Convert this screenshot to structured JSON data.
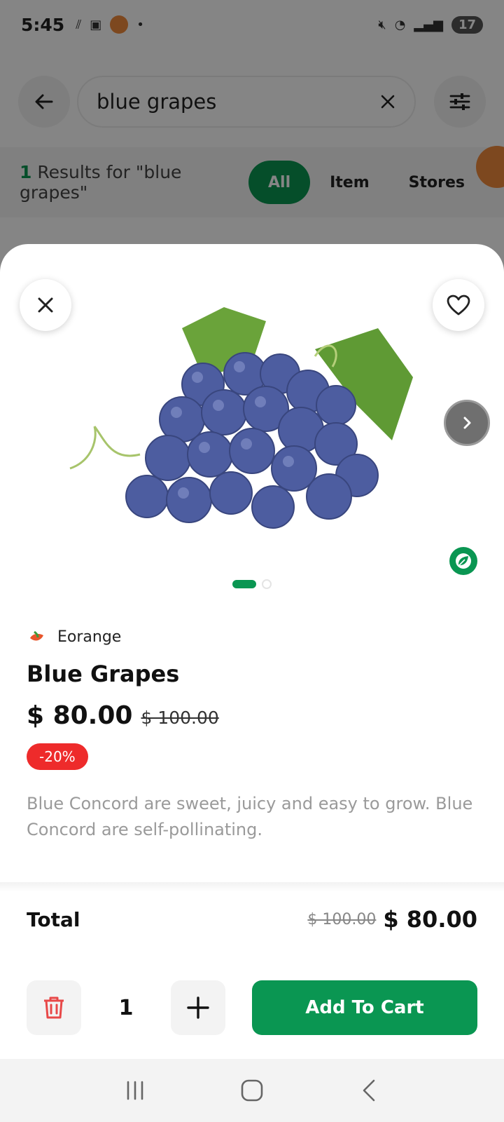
{
  "status_bar": {
    "time": "5:45",
    "battery": "17"
  },
  "search": {
    "query": "blue grapes"
  },
  "results": {
    "count": "1",
    "label": " Results for \"blue grapes\"",
    "filters": [
      "All",
      "Item",
      "Stores"
    ]
  },
  "product": {
    "store": "Eorange",
    "name": "Blue Grapes",
    "price": "$ 80.00",
    "old_price": "$ 100.00",
    "discount": "-20%",
    "description": "Blue Concord are sweet, juicy and easy to grow. Blue Concord are self-pollinating.",
    "image_count": 2,
    "active_image": 1
  },
  "cart": {
    "total_label": "Total",
    "total_old_price": "$ 100.00",
    "total_price": "$ 80.00",
    "quantity": "1",
    "add_to_cart_label": "Add To Cart"
  },
  "colors": {
    "brand_green": "#0a9652",
    "discount_red": "#ee2b2b",
    "accent_orange": "#f08a3c"
  }
}
